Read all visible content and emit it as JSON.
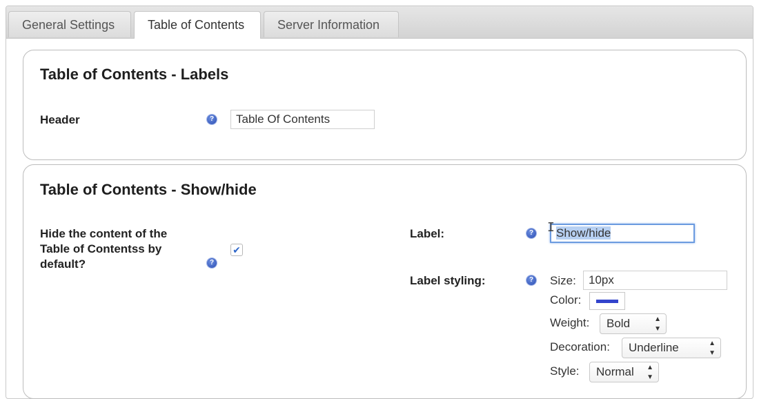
{
  "tabs": [
    {
      "label": "General Settings",
      "active": false
    },
    {
      "label": "Table of Contents",
      "active": true
    },
    {
      "label": "Server Information",
      "active": false
    }
  ],
  "labels_section": {
    "title": "Table of Contents - Labels",
    "header_label": "Header",
    "header_value": "Table Of Contents"
  },
  "showhide_section": {
    "title": "Table of Contents - Show/hide",
    "hide_question": "Hide the content of the Table of Contentss by default?",
    "hide_checked": true,
    "label_label": "Label:",
    "label_value": "Show/hide",
    "styling_label": "Label styling:",
    "size_label": "Size:",
    "size_value": "10px",
    "color_label": "Color:",
    "color_value": "#3344cc",
    "weight_label": "Weight:",
    "weight_value": "Bold",
    "decoration_label": "Decoration:",
    "decoration_value": "Underline",
    "style_label": "Style:",
    "style_value": "Normal"
  },
  "icons": {
    "help": "help-icon",
    "checkmark": "checkmark-icon",
    "select_arrows": "select-arrows-icon",
    "text_cursor": "text-cursor-icon"
  }
}
